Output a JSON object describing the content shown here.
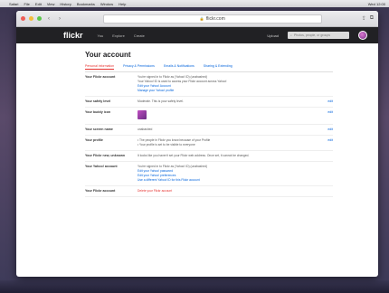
{
  "menubar": {
    "items": [
      "Safari",
      "File",
      "Edit",
      "View",
      "History",
      "Bookmarks",
      "Window",
      "Help"
    ],
    "right": "Wed 12:00"
  },
  "browser": {
    "url": "flickr.com",
    "back_icon": "chevron-left-icon",
    "forward_icon": "chevron-right-icon"
  },
  "flickr_nav": {
    "logo": "flickr",
    "links": [
      "You",
      "Explore",
      "Create"
    ],
    "upload": "Upload",
    "search_placeholder": "Photos, people, or groups"
  },
  "page": {
    "title": "Your account",
    "tabs": [
      "Personal information",
      "Privacy & Permissions",
      "Emails & Notifications",
      "Sharing & Extending"
    ]
  },
  "rows": [
    {
      "label": "Your Flickr account",
      "lines": [
        "You're signed in to Flickr as (Yahoo! ID) (unabashed)",
        "Your Yahoo! ID is used to access your Flickr account across Yahoo!"
      ],
      "links": [
        "Edit your Yahoo! Account",
        "Manage your Yahoo! profile"
      ],
      "edit": ""
    },
    {
      "label": "Your safety level",
      "lines": [
        "Moderate. This is your safety level."
      ],
      "links": [],
      "edit": "edit"
    },
    {
      "label": "Your buddy icon",
      "lines": [],
      "links": [],
      "edit": "edit",
      "icon": true
    },
    {
      "label": "Your screen name",
      "lines": [
        "unabashed"
      ],
      "links": [],
      "edit": "edit"
    },
    {
      "label": "Your profile",
      "lines": [
        "The people in Flickr you know because of your Profile",
        "Your profile is set to be visible to everyone"
      ],
      "links": [],
      "edit": "edit",
      "bullets": true
    },
    {
      "label": "Your Flickr new, unknown",
      "lines": [
        "It looks like you haven't set your Flickr web address. Once set, it cannot be changed."
      ],
      "links": [],
      "edit": ""
    },
    {
      "label": "Your Yahoo! account",
      "lines": [
        "You're signed in to Flickr as (Yahoo! ID) (unabashed)"
      ],
      "links": [
        "Edit your Yahoo! password",
        "Edit your Yahoo! preferences",
        "Use a different Yahoo! ID for this Flickr account"
      ],
      "edit": ""
    },
    {
      "label": "Your Flickr account",
      "lines": [],
      "links": [],
      "edit": "",
      "delete": "Delete your Flickr account"
    }
  ]
}
